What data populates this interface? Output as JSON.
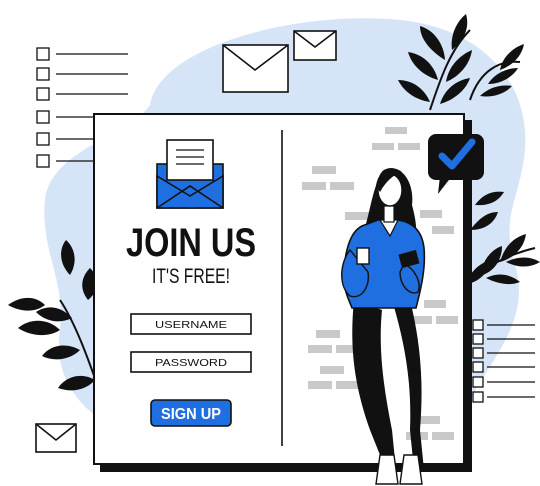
{
  "signup_card": {
    "headline": "JOIN US",
    "subhead": "IT'S FREE!",
    "username_label": "USERNAME",
    "password_label": "PASSWORD",
    "signup_button_label": "SIGN UP"
  },
  "colors": {
    "blob": "#d6e4f8",
    "accent_blue": "#1f6fe0",
    "ink": "#111111",
    "brick": "#c9c9c9",
    "paper": "#ffffff"
  },
  "icons": [
    "envelope-icon",
    "checkmark-badge-icon",
    "checklist-icon",
    "leaf-icon"
  ]
}
